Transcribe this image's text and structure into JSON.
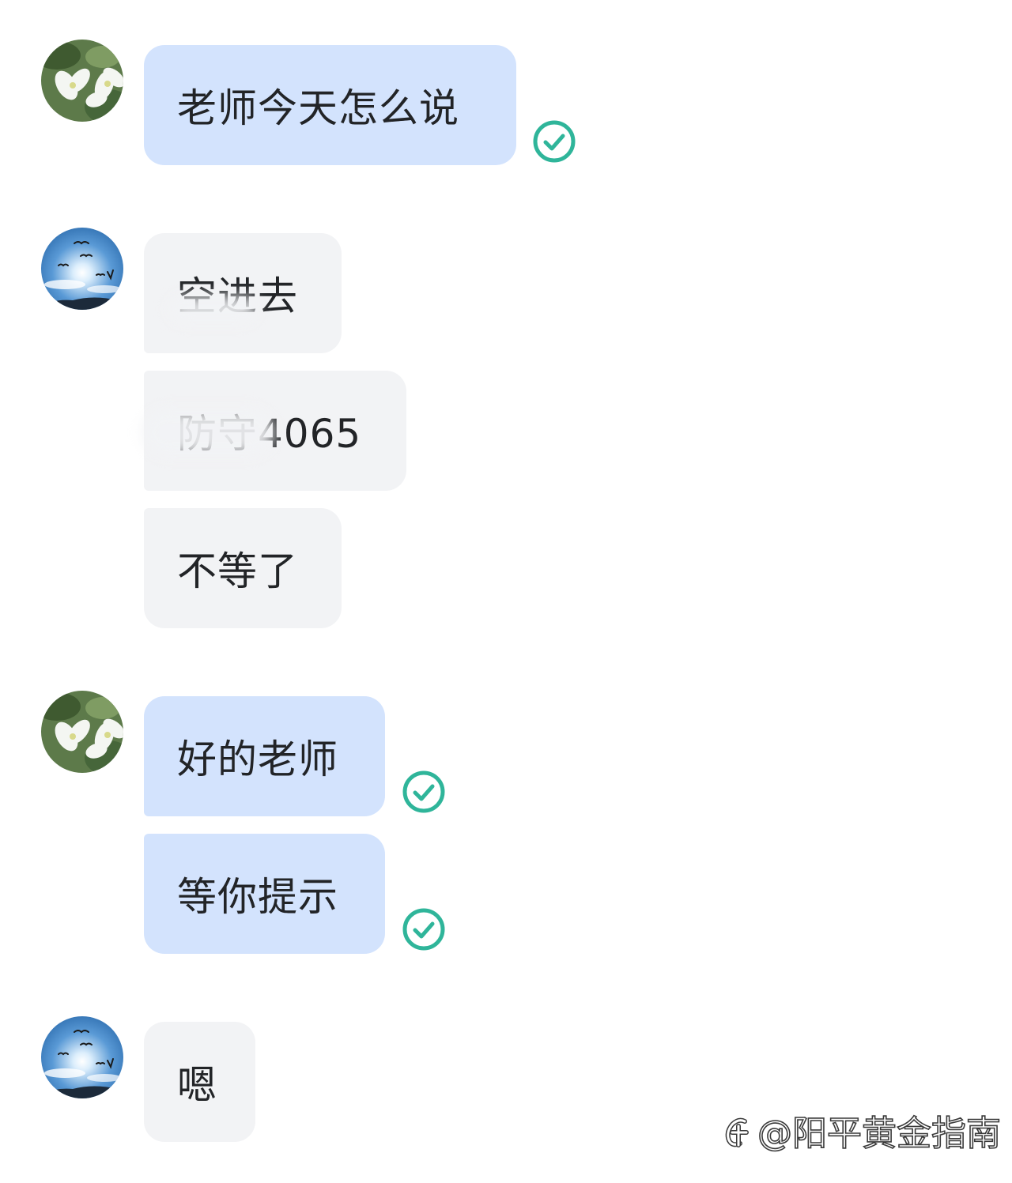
{
  "conversation": {
    "messages": [
      {
        "sender": "me",
        "avatar": "flower-avatar",
        "text": "老师今天怎么说",
        "status": "read"
      },
      {
        "sender": "other",
        "avatar": "sky-bird-avatar",
        "text": "空进去"
      },
      {
        "sender": "other",
        "text": "防守4065"
      },
      {
        "sender": "other",
        "text": "不等了"
      },
      {
        "sender": "me",
        "avatar": "flower-avatar",
        "text": "好的老师",
        "status": "read"
      },
      {
        "sender": "me",
        "text": "等你提示",
        "status": "read"
      },
      {
        "sender": "other",
        "avatar": "sky-bird-avatar",
        "text": "嗯"
      }
    ]
  },
  "watermark": {
    "text": "@阳平黄金指南",
    "icon": "zhihu-logo-icon"
  },
  "colors": {
    "my_bubble": "#d3e3fd",
    "other_bubble": "#f2f3f5",
    "read_check": "#2fb59a",
    "text": "#222427"
  }
}
